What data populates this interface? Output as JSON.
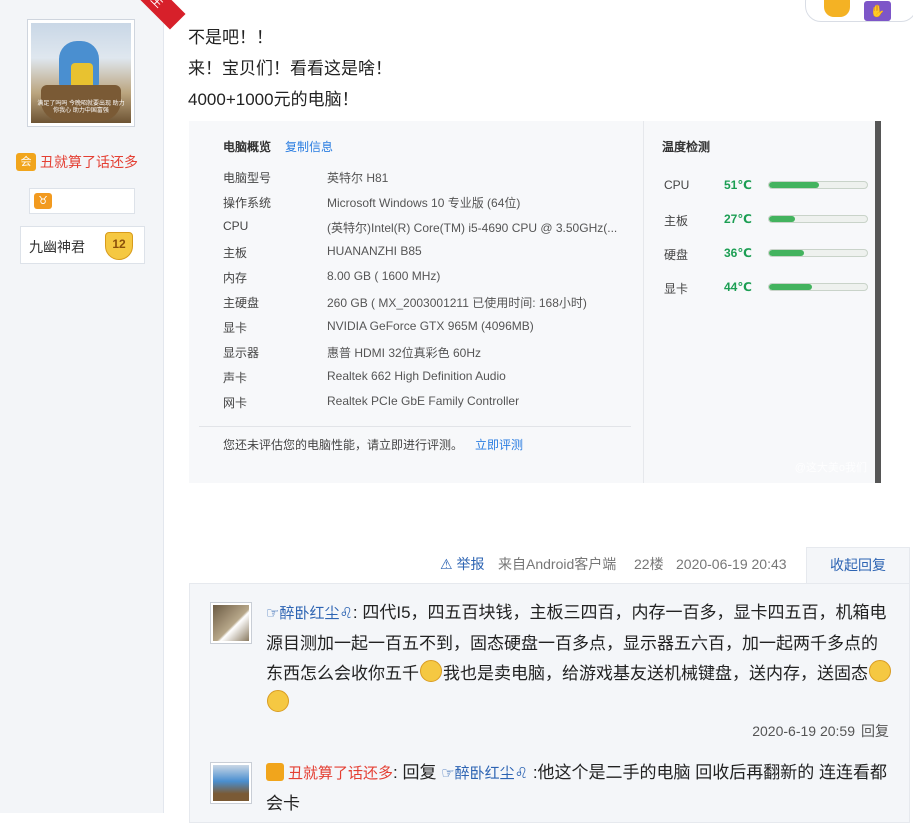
{
  "author": {
    "ribbon": "楼主",
    "avatar_caption": "满足了吗吗\n今晚昭就要出现\n助力你我心\n助力中国富强",
    "nickname": "丑就算了话还多",
    "badge_name": "九幽神君",
    "badge_level": "12"
  },
  "post": {
    "lines": [
      "不是吧！！",
      "来！宝贝们！看看这是啥！",
      "4000+1000元的电脑！"
    ]
  },
  "screenshot": {
    "title": "电脑概览",
    "copy_label": "复制信息",
    "specs": [
      {
        "k": "电脑型号",
        "v": "英特尔 H81"
      },
      {
        "k": "操作系统",
        "v": "Microsoft Windows 10 专业版 (64位)"
      },
      {
        "k": "CPU",
        "v": "(英特尔)Intel(R) Core(TM) i5-4690 CPU @ 3.50GHz(..."
      },
      {
        "k": "主板",
        "v": "HUANANZHI B85"
      },
      {
        "k": "内存",
        "v": "8.00 GB (   1600 MHz)"
      },
      {
        "k": "主硬盘",
        "v": "260 GB (  MX_2003001211 已使用时间: 168小时)"
      },
      {
        "k": "显卡",
        "v": "NVIDIA GeForce GTX 965M (4096MB)"
      },
      {
        "k": "显示器",
        "v": "惠普 HDMI 32位真彩色 60Hz"
      },
      {
        "k": "声卡",
        "v": "Realtek 662 High Definition Audio"
      },
      {
        "k": "网卡",
        "v": "Realtek PCIe GbE Family Controller"
      }
    ],
    "note": "您还未评估您的电脑性能，请立即进行评测。",
    "note_link": "立即评测",
    "temp_title": "温度检测",
    "temps": [
      {
        "k": "CPU",
        "v": "51℃",
        "level": 0.51
      },
      {
        "k": "主板",
        "v": "27℃",
        "level": 0.27
      },
      {
        "k": "硬盘",
        "v": "36℃",
        "level": 0.36
      },
      {
        "k": "显卡",
        "v": "44℃",
        "level": 0.44
      }
    ],
    "watermark": "@这大美o我们"
  },
  "meta": {
    "report": "举报",
    "from": "来自Android客户端",
    "floor": "22楼",
    "time": "2020-06-19 20:43",
    "collapse": "收起回复"
  },
  "reply1": {
    "user": "☞醉卧红尘♌",
    "text_a": ": 四代I5，四五百块钱，主板三四百，内存一百多，显卡四五百，机箱电源目测加一起一百五不到，固态硬盘一百多点，显示器五六百，加一起两千多点的东西怎么会收你五千",
    "text_b": "我也是卖电脑，给游戏基友送机械键盘，送内存，送固态",
    "time": "2020-6-19 20:59",
    "reply_label": "回复"
  },
  "reply2": {
    "user": "丑就算了话还多",
    "prefix": ": 回复 ",
    "target": "☞醉卧红尘♌",
    "text": " :他这个是二手的电脑 回收后再翻新的 连连看都会卡"
  },
  "colors": {
    "link": "#2d64b3",
    "red": "#e43f33",
    "temp_green": "#1c9e53"
  }
}
